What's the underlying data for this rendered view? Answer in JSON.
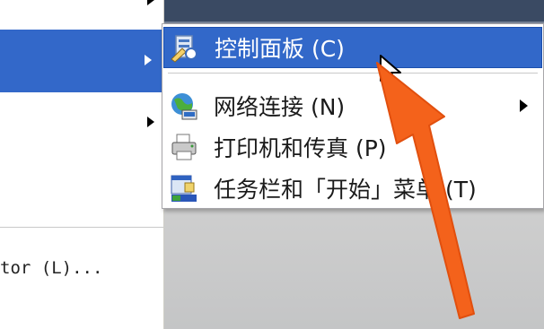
{
  "start_menu_left": {
    "logoff_text": "tor (L)..."
  },
  "submenu": {
    "items": [
      {
        "label": "控制面板 (C)",
        "icon": "control-panel-icon",
        "selected": true,
        "has_submenu": false
      },
      {
        "label": "网络连接 (N)",
        "icon": "network-connections-icon",
        "selected": false,
        "has_submenu": true
      },
      {
        "label": "打印机和传真 (P)",
        "icon": "printer-icon",
        "selected": false,
        "has_submenu": false
      },
      {
        "label": "任务栏和「开始」菜单 (T)",
        "icon": "taskbar-icon",
        "selected": false,
        "has_submenu": false
      }
    ]
  },
  "colors": {
    "highlight": "#3268c9",
    "annotation_arrow": "#f4621b"
  }
}
